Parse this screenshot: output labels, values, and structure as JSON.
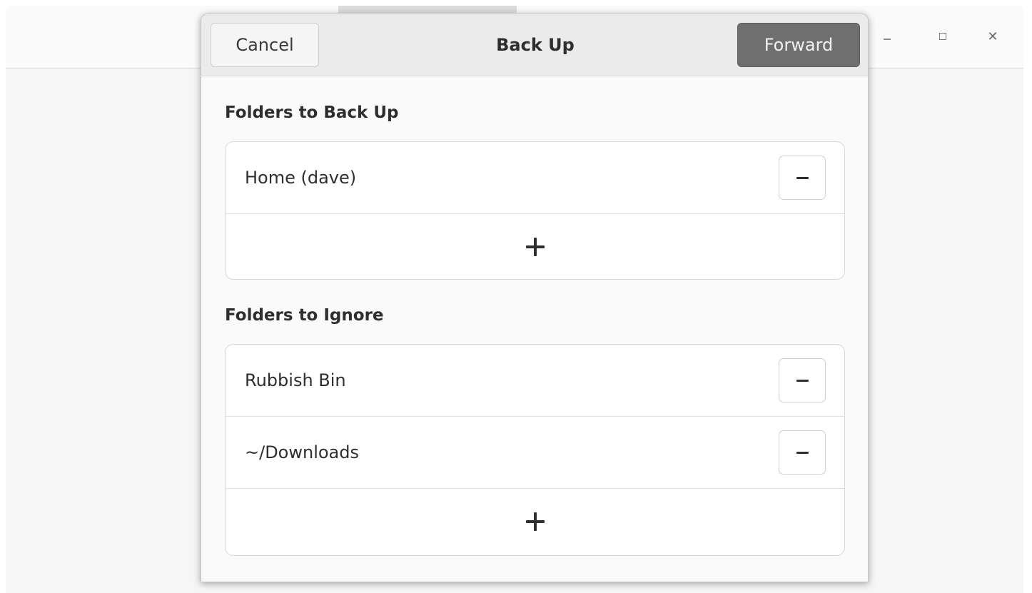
{
  "dialog": {
    "title": "Back Up",
    "cancel_label": "Cancel",
    "forward_label": "Forward"
  },
  "sections": {
    "backup": {
      "title": "Folders to Back Up",
      "items": [
        {
          "label": "Home (dave)"
        }
      ]
    },
    "ignore": {
      "title": "Folders to Ignore",
      "items": [
        {
          "label": "Rubbish Bin"
        },
        {
          "label": "~/Downloads"
        }
      ]
    }
  },
  "window_controls": [
    "minimize-icon",
    "maximize-icon",
    "close-icon"
  ],
  "icons": {
    "remove": "minus-icon",
    "add": "plus-icon"
  },
  "colors": {
    "forward_button": "#6f6f6f",
    "dialog_background": "#fafafa",
    "header_background": "#ebebeb"
  }
}
